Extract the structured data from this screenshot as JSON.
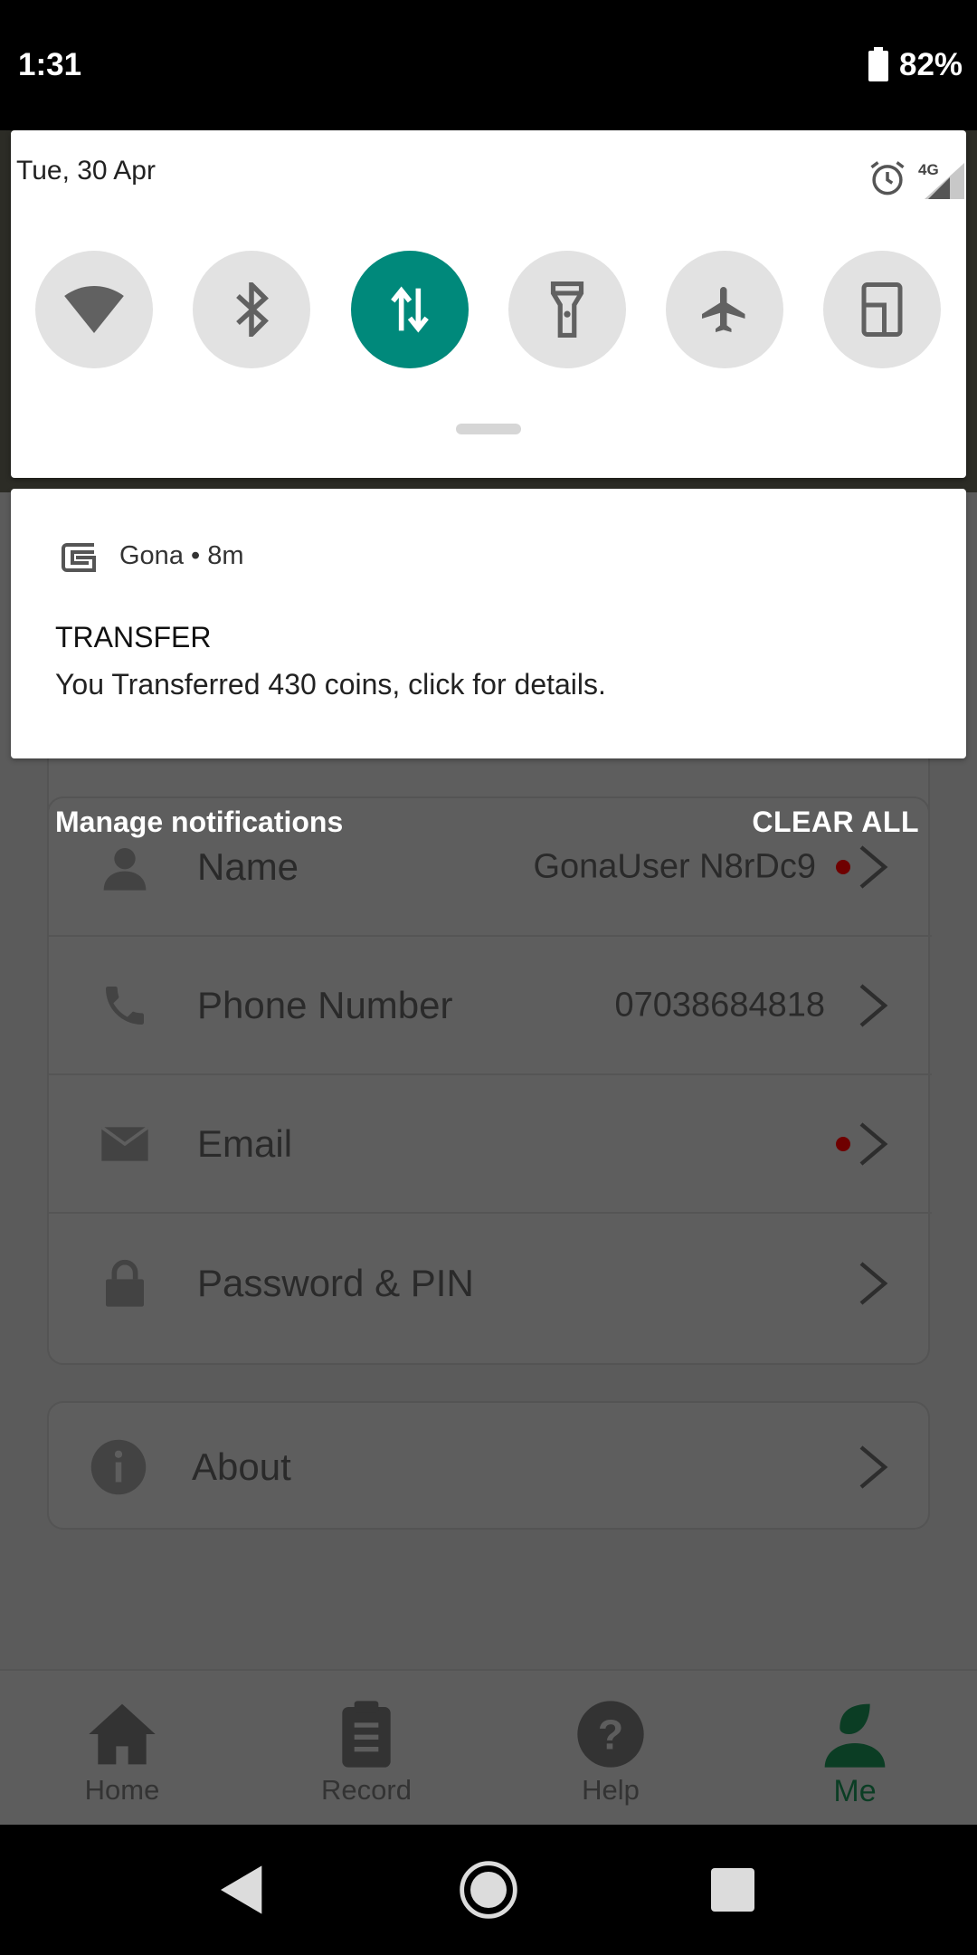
{
  "status_bar": {
    "time": "1:31",
    "battery_percent": "82%",
    "battery_level": 0.82
  },
  "quick_settings": {
    "date": "Tue, 30 Apr",
    "network_type": "4G",
    "tiles": [
      {
        "name": "wifi",
        "icon": "wifi-icon",
        "state": "off"
      },
      {
        "name": "bluetooth",
        "icon": "bluetooth-icon",
        "state": "off"
      },
      {
        "name": "mobile-data",
        "icon": "data-transfer-icon",
        "state": "on"
      },
      {
        "name": "flashlight",
        "icon": "flashlight-icon",
        "state": "off"
      },
      {
        "name": "airplane-mode",
        "icon": "airplane-icon",
        "state": "off"
      },
      {
        "name": "auto-rotate",
        "icon": "rotate-icon",
        "state": "off"
      }
    ],
    "accent_color": "#00897b"
  },
  "notification": {
    "app_name": "Gona",
    "separator": "•",
    "time_ago": "8m",
    "title": "TRANSFER",
    "body": "You Transferred 430 coins, click for details."
  },
  "notification_actions": {
    "manage": "Manage notifications",
    "clear_all": "CLEAR ALL"
  },
  "app": {
    "rows": [
      {
        "label": "Name",
        "value": "GonaUser N8rDc9",
        "icon": "person-icon",
        "has_dot": true
      },
      {
        "label": "Phone Number",
        "value": "07038684818",
        "icon": "phone-icon",
        "has_dot": false
      },
      {
        "label": "Email",
        "value": "",
        "icon": "mail-icon",
        "has_dot": true
      },
      {
        "label": "Password & PIN",
        "value": "",
        "icon": "lock-icon",
        "has_dot": false
      }
    ],
    "about": {
      "label": "About",
      "icon": "info-icon"
    },
    "bottom_nav": [
      {
        "label": "Home",
        "icon": "home-icon",
        "active": false
      },
      {
        "label": "Record",
        "icon": "clipboard-icon",
        "active": false
      },
      {
        "label": "Help",
        "icon": "help-icon",
        "active": false
      },
      {
        "label": "Me",
        "icon": "profile-icon",
        "active": true
      }
    ]
  }
}
